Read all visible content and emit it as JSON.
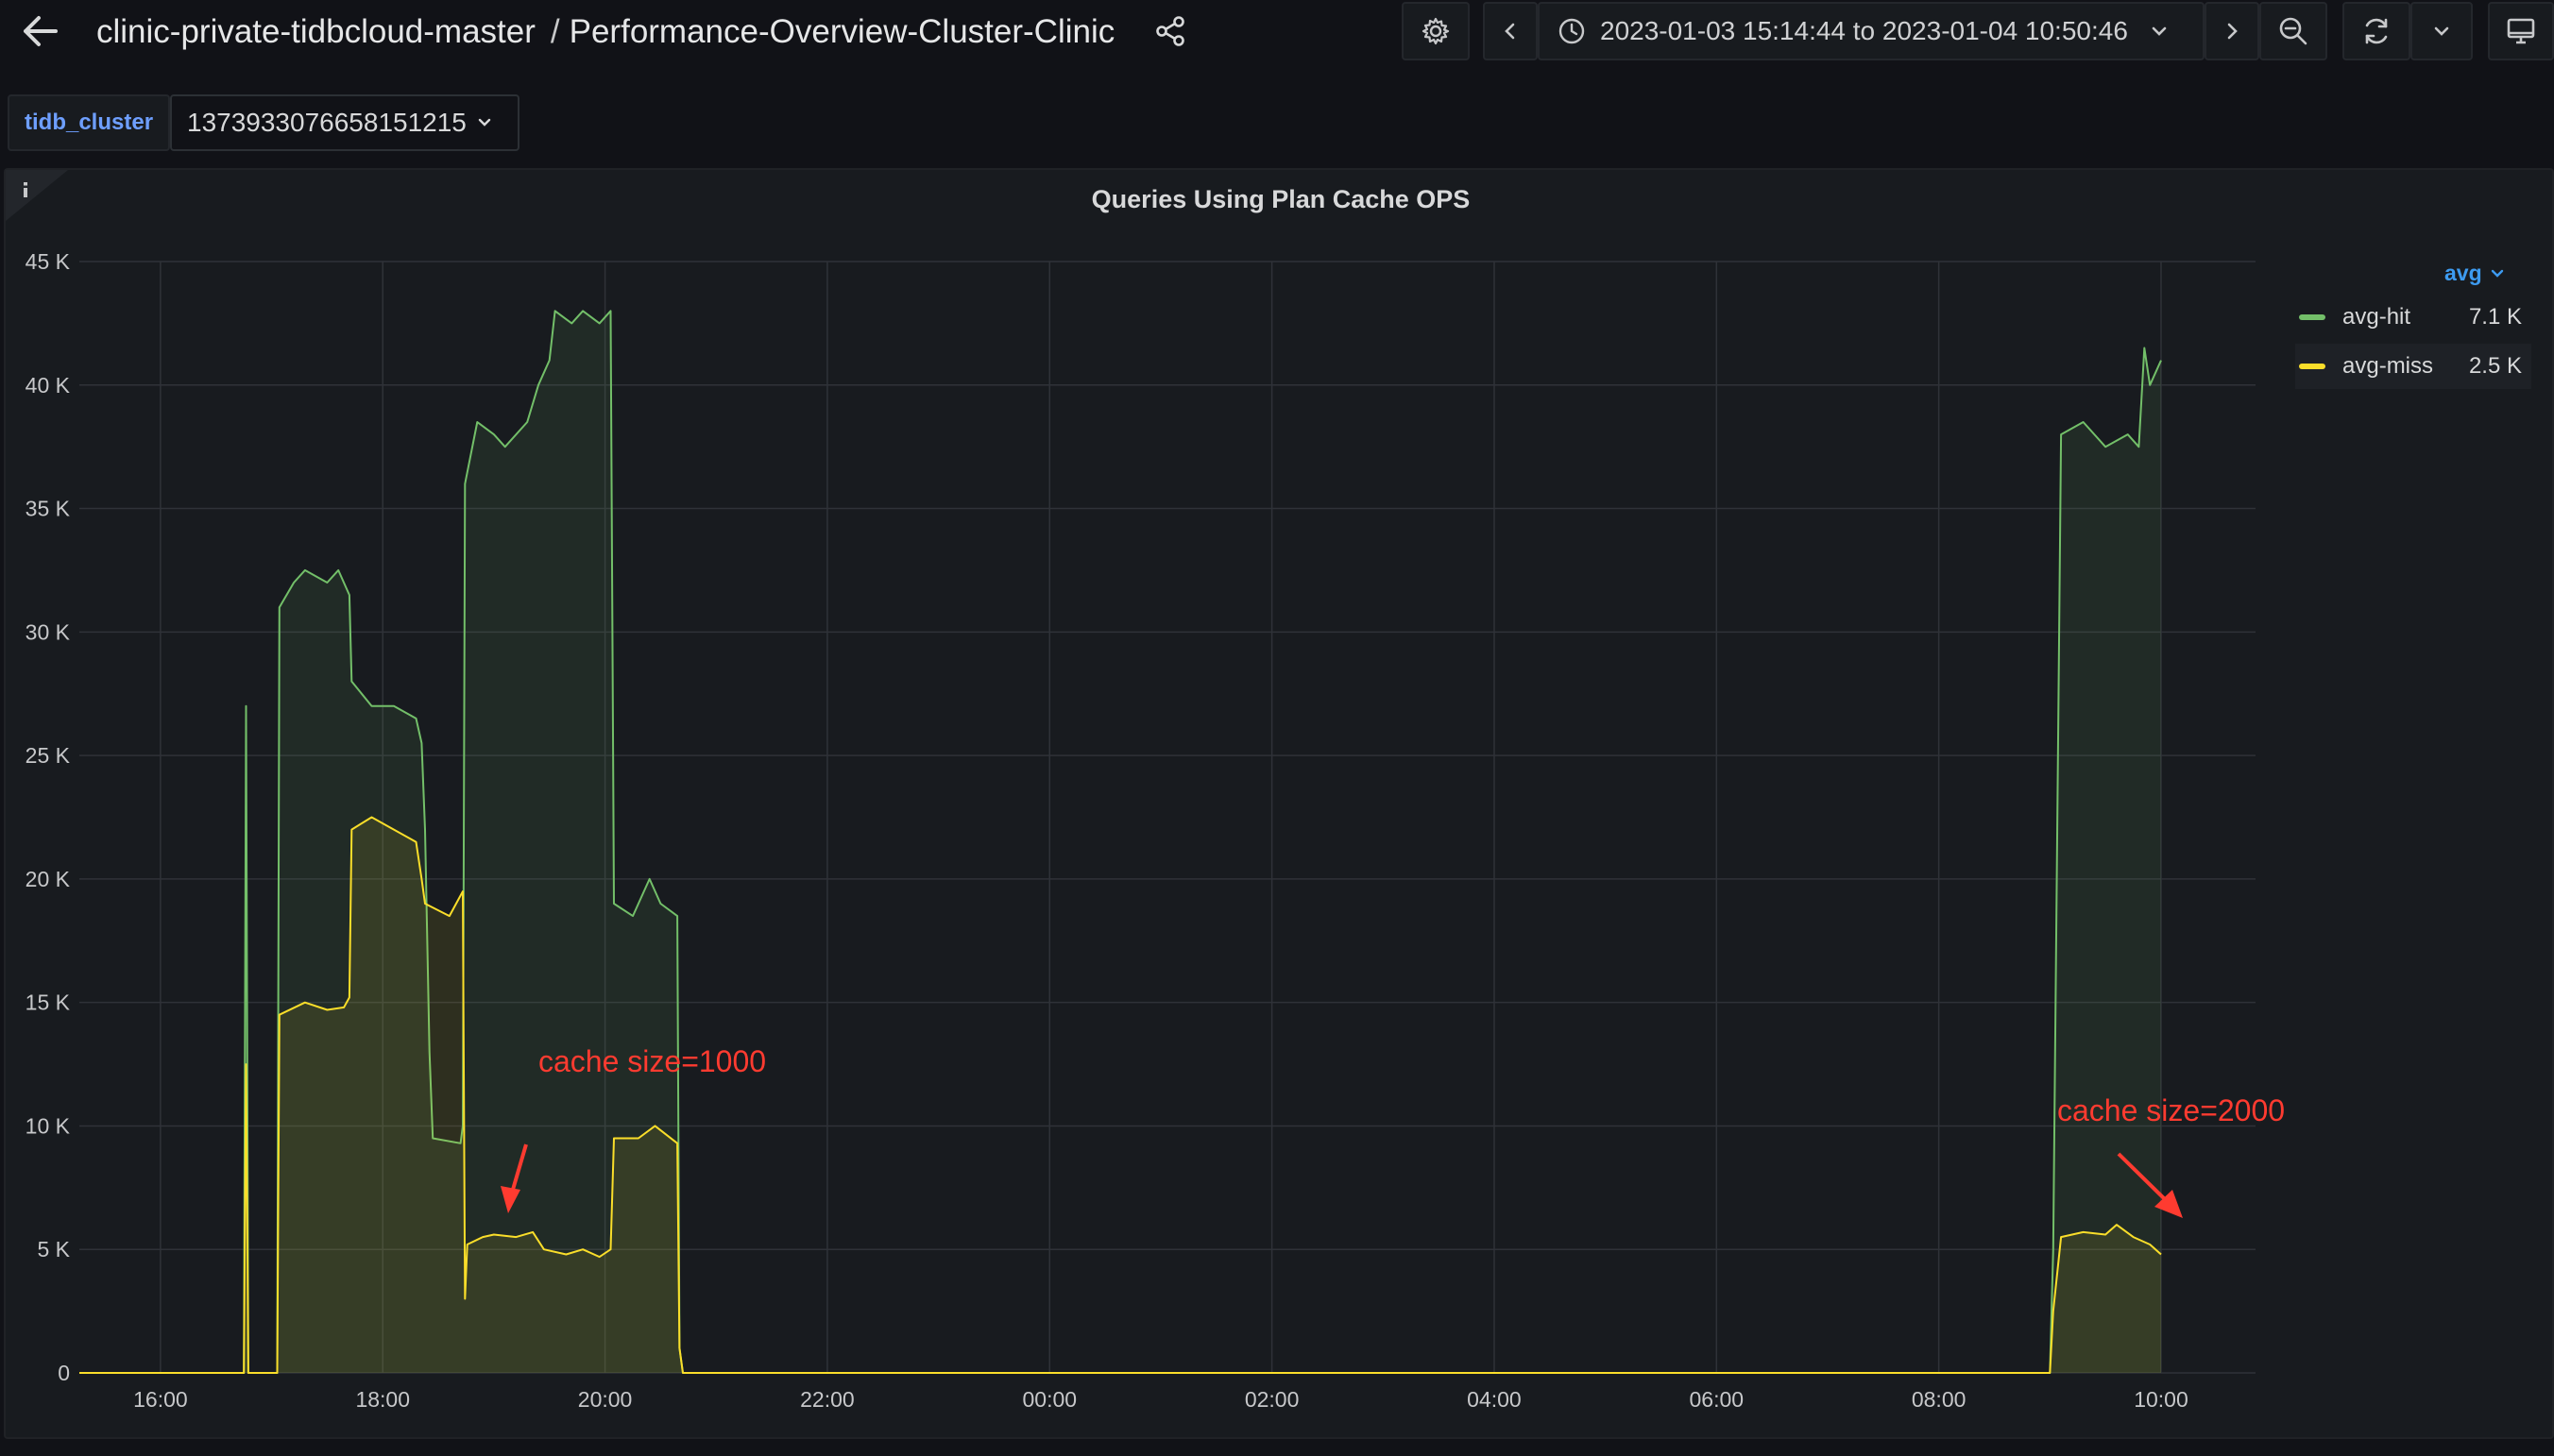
{
  "header": {
    "folder": "clinic-private-tidbcloud-master",
    "separator": "/",
    "dashboard": "Performance-Overview-Cluster-Clinic",
    "time_range": "2023-01-03 15:14:44 to 2023-01-04 10:50:46",
    "icons": {
      "back": "arrow-left-icon",
      "share": "share-icon",
      "settings": "gear-icon",
      "prev": "chevron-left-icon",
      "clock": "clock-icon",
      "range_dropdown": "chevron-down-icon",
      "next": "chevron-right-icon",
      "zoom_out": "zoom-out-icon",
      "refresh": "refresh-icon",
      "refresh_dropdown": "chevron-down-icon",
      "tv_mode": "monitor-icon"
    }
  },
  "variables": {
    "label": "tidb_cluster",
    "value": "1373933076658151215"
  },
  "panel": {
    "info_icon": "info-icon",
    "title": "Queries Using Plan Cache OPS",
    "legend": {
      "sort_label": "avg",
      "items": [
        {
          "name": "avg-hit",
          "value": "7.1 K",
          "color": "#73bf69"
        },
        {
          "name": "avg-miss",
          "value": "2.5 K",
          "color": "#fade2a"
        }
      ]
    },
    "annotations": [
      {
        "text": "cache size=1000",
        "color": "#ff3b30"
      },
      {
        "text": "cache size=2000",
        "color": "#ff3b30"
      }
    ]
  },
  "chart_data": {
    "type": "line",
    "title": "Queries Using Plan Cache OPS",
    "y_ticks": [
      "0",
      "5 K",
      "10 K",
      "15 K",
      "20 K",
      "25 K",
      "30 K",
      "35 K",
      "40 K",
      "45 K"
    ],
    "x_ticks": [
      "16:00",
      "18:00",
      "20:00",
      "22:00",
      "00:00",
      "02:00",
      "04:00",
      "06:00",
      "08:00",
      "10:00"
    ],
    "ylim": [
      0,
      45000
    ],
    "x_unit": "hours since 16:00 on 2023-01-03",
    "xlim": [
      -0.73,
      18.85
    ],
    "grid": true,
    "legend_position": "right",
    "series": [
      {
        "name": "avg-hit",
        "color": "#73bf69",
        "points": [
          [
            -0.73,
            0
          ],
          [
            0.75,
            0
          ],
          [
            0.77,
            27000
          ],
          [
            0.79,
            0
          ],
          [
            1.05,
            0
          ],
          [
            1.07,
            31000
          ],
          [
            1.2,
            32000
          ],
          [
            1.3,
            32500
          ],
          [
            1.5,
            32000
          ],
          [
            1.6,
            32500
          ],
          [
            1.7,
            31500
          ],
          [
            1.72,
            28000
          ],
          [
            1.9,
            27000
          ],
          [
            2.1,
            27000
          ],
          [
            2.3,
            26500
          ],
          [
            2.35,
            25500
          ],
          [
            2.38,
            22000
          ],
          [
            2.42,
            13000
          ],
          [
            2.45,
            9500
          ],
          [
            2.7,
            9300
          ],
          [
            2.72,
            10000
          ],
          [
            2.74,
            36000
          ],
          [
            2.85,
            38500
          ],
          [
            3.0,
            38000
          ],
          [
            3.1,
            37500
          ],
          [
            3.3,
            38500
          ],
          [
            3.4,
            40000
          ],
          [
            3.5,
            41000
          ],
          [
            3.55,
            43000
          ],
          [
            3.7,
            42500
          ],
          [
            3.8,
            43000
          ],
          [
            3.95,
            42500
          ],
          [
            4.05,
            43000
          ],
          [
            4.08,
            19000
          ],
          [
            4.25,
            18500
          ],
          [
            4.4,
            20000
          ],
          [
            4.5,
            19000
          ],
          [
            4.65,
            18500
          ],
          [
            4.67,
            1000
          ],
          [
            4.7,
            0
          ],
          [
            17.0,
            0
          ],
          [
            17.03,
            5000
          ],
          [
            17.1,
            38000
          ],
          [
            17.3,
            38500
          ],
          [
            17.5,
            37500
          ],
          [
            17.7,
            38000
          ],
          [
            17.8,
            37500
          ],
          [
            17.85,
            41500
          ],
          [
            17.9,
            40000
          ],
          [
            18.0,
            41000
          ]
        ]
      },
      {
        "name": "avg-miss",
        "color": "#fade2a",
        "points": [
          [
            -0.73,
            0
          ],
          [
            0.75,
            0
          ],
          [
            0.77,
            12500
          ],
          [
            0.79,
            0
          ],
          [
            1.05,
            0
          ],
          [
            1.07,
            14500
          ],
          [
            1.3,
            15000
          ],
          [
            1.5,
            14700
          ],
          [
            1.65,
            14800
          ],
          [
            1.7,
            15200
          ],
          [
            1.72,
            22000
          ],
          [
            1.9,
            22500
          ],
          [
            2.1,
            22000
          ],
          [
            2.3,
            21500
          ],
          [
            2.35,
            20000
          ],
          [
            2.38,
            19000
          ],
          [
            2.6,
            18500
          ],
          [
            2.72,
            19500
          ],
          [
            2.74,
            3000
          ],
          [
            2.76,
            5200
          ],
          [
            2.9,
            5500
          ],
          [
            3.0,
            5600
          ],
          [
            3.2,
            5500
          ],
          [
            3.35,
            5700
          ],
          [
            3.45,
            5000
          ],
          [
            3.65,
            4800
          ],
          [
            3.8,
            5000
          ],
          [
            3.95,
            4700
          ],
          [
            4.05,
            5000
          ],
          [
            4.08,
            9500
          ],
          [
            4.3,
            9500
          ],
          [
            4.45,
            10000
          ],
          [
            4.65,
            9300
          ],
          [
            4.67,
            1000
          ],
          [
            4.7,
            0
          ],
          [
            17.0,
            0
          ],
          [
            17.03,
            2500
          ],
          [
            17.1,
            5500
          ],
          [
            17.3,
            5700
          ],
          [
            17.5,
            5600
          ],
          [
            17.6,
            6000
          ],
          [
            17.75,
            5500
          ],
          [
            17.9,
            5200
          ],
          [
            18.0,
            4800
          ]
        ]
      }
    ]
  }
}
